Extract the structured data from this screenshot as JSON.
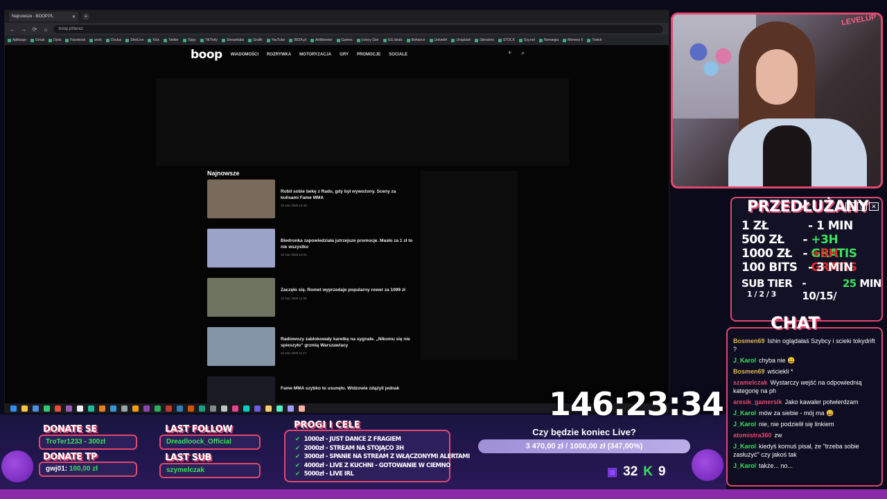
{
  "browser": {
    "tab_title": "Najnowsze - BOOP.PL",
    "url": "boop.pl/teraz",
    "bookmarks": [
      "Aplikacje",
      "Gmail",
      "Dysk",
      "Facebook",
      "work",
      "Oculus",
      "ShinLive",
      "Kick",
      "Twitter",
      "Tippy",
      "TikTinity",
      "Streamlabs",
      "Grafik",
      "YouTube",
      "IBIZA.pl",
      "ArtMonster",
      "Games",
      "Łowcy Gier",
      "GG.deals",
      "Behance",
      "LinkedIn",
      "Unsplash",
      "Skinsters",
      "STOCK",
      "Gry.net",
      "Norwegia",
      "Memory 5",
      "Twitch"
    ]
  },
  "site": {
    "logo": "boop",
    "nav": [
      "WIADOMOŚCI",
      "ROZRYWKA",
      "MOTORYZACJA",
      "GRY",
      "PROMOCJE",
      "SOCIALE"
    ],
    "section_title": "Najnowsze",
    "articles": [
      {
        "title": "Robił sobie bekę z Rado, gdy był wywożony. Sceny za kulisami Fame MMA",
        "date": "22 mar 2025 12:49",
        "thumb": "#7a6a5a"
      },
      {
        "title": "Biedronka zapowiedziała jutrzejsze promocje. Masło za 1 zł to nie wszystko",
        "date": "22 mar 2025 12:01",
        "thumb": "#9aa3c8"
      },
      {
        "title": "Zaczęło się. Romet wyprzedaje popularny rower za 1099 zł",
        "date": "22 mar 2025 11:50",
        "thumb": "#6e7360"
      },
      {
        "title": "Radiowozy zablokowały karetkę na sygnale. „Nikomu się nie spieszyło” grzmią Warszawiacy",
        "date": "22 mar 2025 11:17",
        "thumb": "#8595a8"
      },
      {
        "title": "Fame MMA szybko to usunęło. Widzowie zdążyli jednak",
        "date": "",
        "thumb": "#1a1a24"
      }
    ]
  },
  "overlay": {
    "brand": "LEVELUP",
    "przedluzany_title": "PRZEDŁUŻANY",
    "rates": [
      {
        "k": "1 ZŁ",
        "v1": "- 1 MIN",
        "v2": ""
      },
      {
        "k": "500 ZŁ",
        "v1": "- ",
        "v2": "+3H GRATIS"
      },
      {
        "k": "1000 ZŁ",
        "v1": "- ",
        "v2": "+8H GRATIS"
      },
      {
        "k": "100 BITS",
        "v1": "- 3 MIN",
        "v2": ""
      }
    ],
    "sub_tier": "SUB TIER",
    "sub_tiers": "1 / 2 / 3",
    "sub_values": "- 10/15/",
    "sub_value_hl": "25",
    "sub_suffix": " MIN",
    "chat_title": "CHAT",
    "chat": [
      {
        "u": "Bosmen69",
        "c": "#e0b84a",
        "t": "Ishin oglądałaś Szybcy i scieki tokydrift ?"
      },
      {
        "u": "J_Karol",
        "c": "#38e45c",
        "t": "chyba nie 😄"
      },
      {
        "u": "Bosmen69",
        "c": "#e0b84a",
        "t": "wściekli *"
      },
      {
        "u": "szamelczak",
        "c": "#e0496e",
        "t": "Wystarczy wejść na odpowiednią kategorię na ph"
      },
      {
        "u": "aresik_gamersik",
        "c": "#e0496e",
        "t": "Jako kawaler potwierdzam"
      },
      {
        "u": "J_Karol",
        "c": "#38e45c",
        "t": "mów za siebie - mój ma 😄"
      },
      {
        "u": "J_Karol",
        "c": "#38e45c",
        "t": "nie, nie podzielił się linkiem"
      },
      {
        "u": "atomistra360",
        "c": "#e0496e",
        "t": "zw"
      },
      {
        "u": "J_Karol",
        "c": "#38e45c",
        "t": "kiedyś komuś pisał, że \"trzeba sobie zasłużyć\" czy jakoś tak"
      },
      {
        "u": "J_Karol",
        "c": "#38e45c",
        "t": "także... no..."
      }
    ],
    "timer": "146:23:34",
    "donate_se_label": "DONATE SE",
    "donate_se_value": "TroTer1233 - 300zł",
    "last_follow_label": "LAST FOLLOW",
    "last_follow_value": "Dreadloock_Official",
    "donate_tp_label": "DONATE TP",
    "donate_tp_user": "gwj01:",
    "donate_tp_amount": "100,00 zł",
    "last_sub_label": "LAST SUB",
    "last_sub_value": "szymelczak",
    "goals_title": "PROGI I CELE",
    "goals": [
      "1000zł - JUST DANCE Z FRAGIEM",
      "2000zł - STREAM NA STOJĄCO 3H",
      "3000zł - SPANIE NA STREAM Z WŁĄCZONYMI ALERTAMI",
      "4000zł - LIVE Z KUCHNI - GOTOWANIE W CIEMNO",
      "5000zł - LIVE IRL"
    ],
    "progress_question": "Czy będzie koniec Live?",
    "progress_text": "3 470,00 zł / 1000,00 zł (347,00%)",
    "progress_fraction": 1.0,
    "viewers": "32",
    "kick_count": "9",
    "kick_letter": "K",
    "accent": "#e0496e",
    "green": "#38e45c"
  }
}
